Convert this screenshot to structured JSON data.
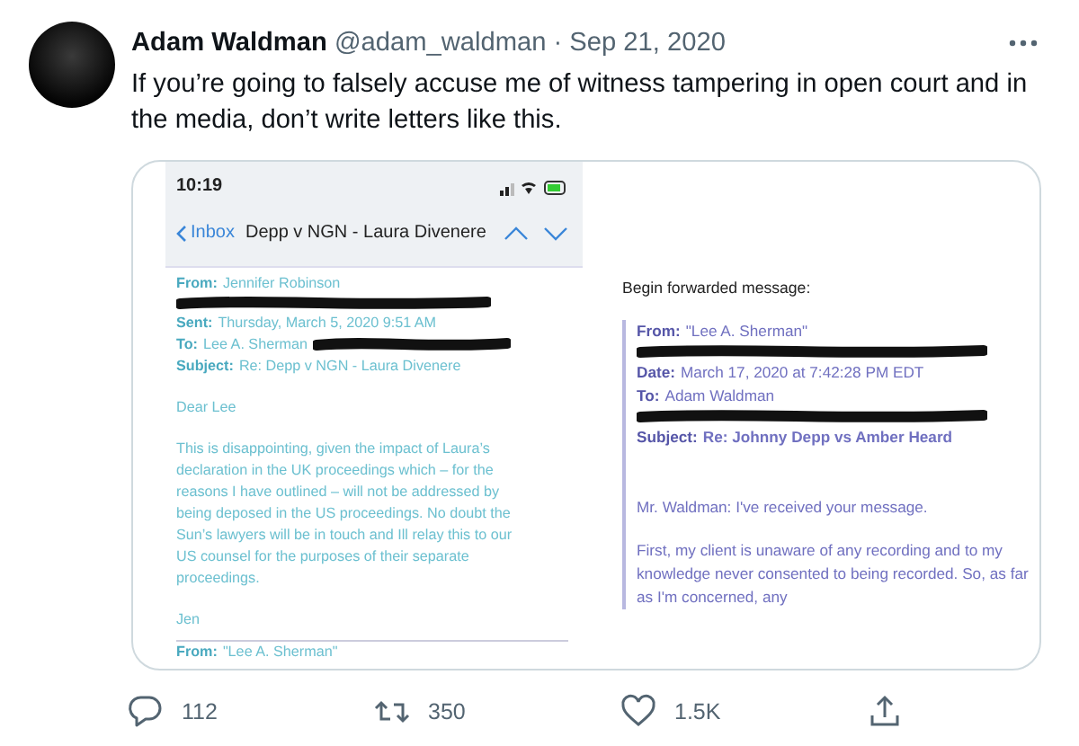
{
  "tweet": {
    "author": "Adam Waldman",
    "handle": "@adam_waldman",
    "separator": "·",
    "date": "Sep 21, 2020",
    "text": "If you’re going to falsely accuse me of witness tampering in open court and in the media, don’t write letters like this.",
    "attachment": {
      "left_email": {
        "status_time": "10:19",
        "back_label": "Inbox",
        "subject_title": "Depp v NGN - Laura Divenere",
        "fields": [
          {
            "kind": "field",
            "label": "From:",
            "value": "Jennifer Robinson",
            "redacted_after": false
          },
          {
            "kind": "redacted"
          },
          {
            "kind": "field",
            "label": "Sent:",
            "value": "Thursday, March 5, 2020 9:51 AM",
            "redacted_after": false
          },
          {
            "kind": "field",
            "label": "To:",
            "value": "Lee A. Sherman",
            "redacted_after": true
          },
          {
            "kind": "field",
            "label": "Subject:",
            "value": "Re: Depp v NGN - Laura Divenere",
            "redacted_after": false
          }
        ],
        "body": [
          "Dear Lee",
          "This is disappointing, given the impact of Laura’s declaration in the UK proceedings which – for the reasons I have outlined – will not be addressed by being deposed in the US proceedings. No doubt the Sun’s lawyers will be in touch and Ill relay this to our US counsel for the purposes of their separate proceedings.",
          "Jen"
        ],
        "next_from": {
          "label": "From:",
          "value": "\"Lee A. Sherman\""
        }
      },
      "right_email": {
        "intro": "Begin forwarded message:",
        "fields": [
          {
            "kind": "field",
            "label": "From:",
            "value": "\"Lee A. Sherman\""
          },
          {
            "kind": "redacted"
          },
          {
            "kind": "field",
            "label": "Date:",
            "value": "March 17, 2020 at 7:42:28 PM EDT"
          },
          {
            "kind": "field",
            "label": "To:",
            "value": "Adam Waldman"
          },
          {
            "kind": "redacted"
          },
          {
            "kind": "field",
            "label": "Subject:",
            "value": "Re: Johnny Depp vs Amber Heard"
          }
        ],
        "body": [
          "Mr. Waldman: I've received your message.",
          "First, my client is unaware of any recording and to my knowledge never consented to being recorded. So, as far as I'm concerned, any"
        ]
      }
    },
    "actions": [
      {
        "kind": "reply",
        "count": "112"
      },
      {
        "kind": "retweet",
        "count": "350"
      },
      {
        "kind": "like",
        "count": "1.5K"
      },
      {
        "kind": "share"
      }
    ]
  }
}
